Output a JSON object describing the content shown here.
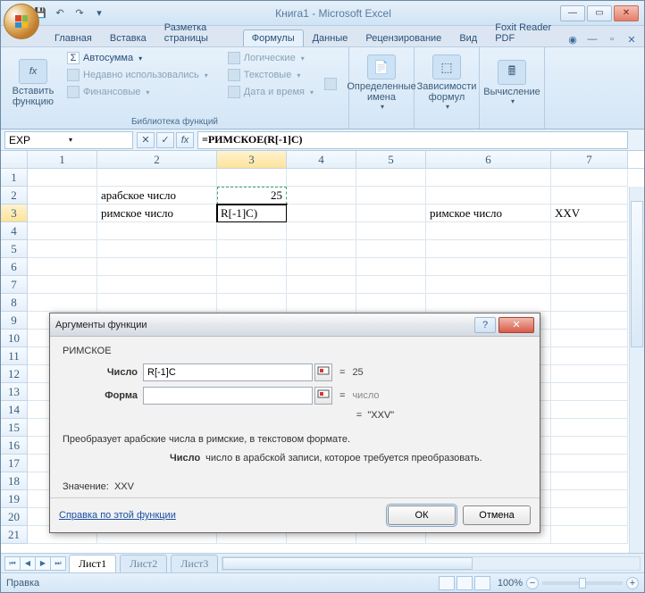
{
  "title": "Книга1 - Microsoft Excel",
  "tabs": {
    "home": "Главная",
    "insert": "Вставка",
    "layout": "Разметка страницы",
    "formulas": "Формулы",
    "data": "Данные",
    "review": "Рецензирование",
    "view": "Вид",
    "foxit": "Foxit Reader PDF"
  },
  "ribbon": {
    "insert_function": "Вставить функцию",
    "library": "Библиотека функций",
    "autosum": "Автосумма",
    "recent": "Недавно использовались",
    "financial": "Финансовые",
    "logical": "Логические",
    "text": "Текстовые",
    "datetime": "Дата и время",
    "defined_names": "Определенные имена",
    "formula_deps": "Зависимости формул",
    "calculation": "Вычисление"
  },
  "namebox": "EXP",
  "formula": "=РИМСКОЕ(R[-1]C)",
  "cols": [
    "1",
    "2",
    "3",
    "4",
    "5",
    "6",
    "7"
  ],
  "grid": {
    "r2c2": "арабское число",
    "r2c3": "25",
    "r3c2": "римское число",
    "r3c3": "R[-1]C)",
    "r3c6": "римское число",
    "r3c7": "XXV"
  },
  "sheets": {
    "s1": "Лист1",
    "s2": "Лист2",
    "s3": "Лист3"
  },
  "status": {
    "mode": "Правка",
    "zoom": "100%"
  },
  "dialog": {
    "title": "Аргументы функции",
    "fname": "РИМСКОЕ",
    "arg1_label": "Число",
    "arg1_value": "R[-1]C",
    "arg1_result": "25",
    "arg2_label": "Форма",
    "arg2_value": "",
    "arg2_result": "число",
    "eq": "=",
    "preview": "\"XXV\"",
    "desc": "Преобразует арабские числа в римские, в текстовом формате.",
    "arg_desc_label": "Число",
    "arg_desc": "число в арабской записи, которое требуется преобразовать.",
    "value_label": "Значение:",
    "value": "XXV",
    "help_link": "Справка по этой функции",
    "ok": "ОК",
    "cancel": "Отмена"
  }
}
